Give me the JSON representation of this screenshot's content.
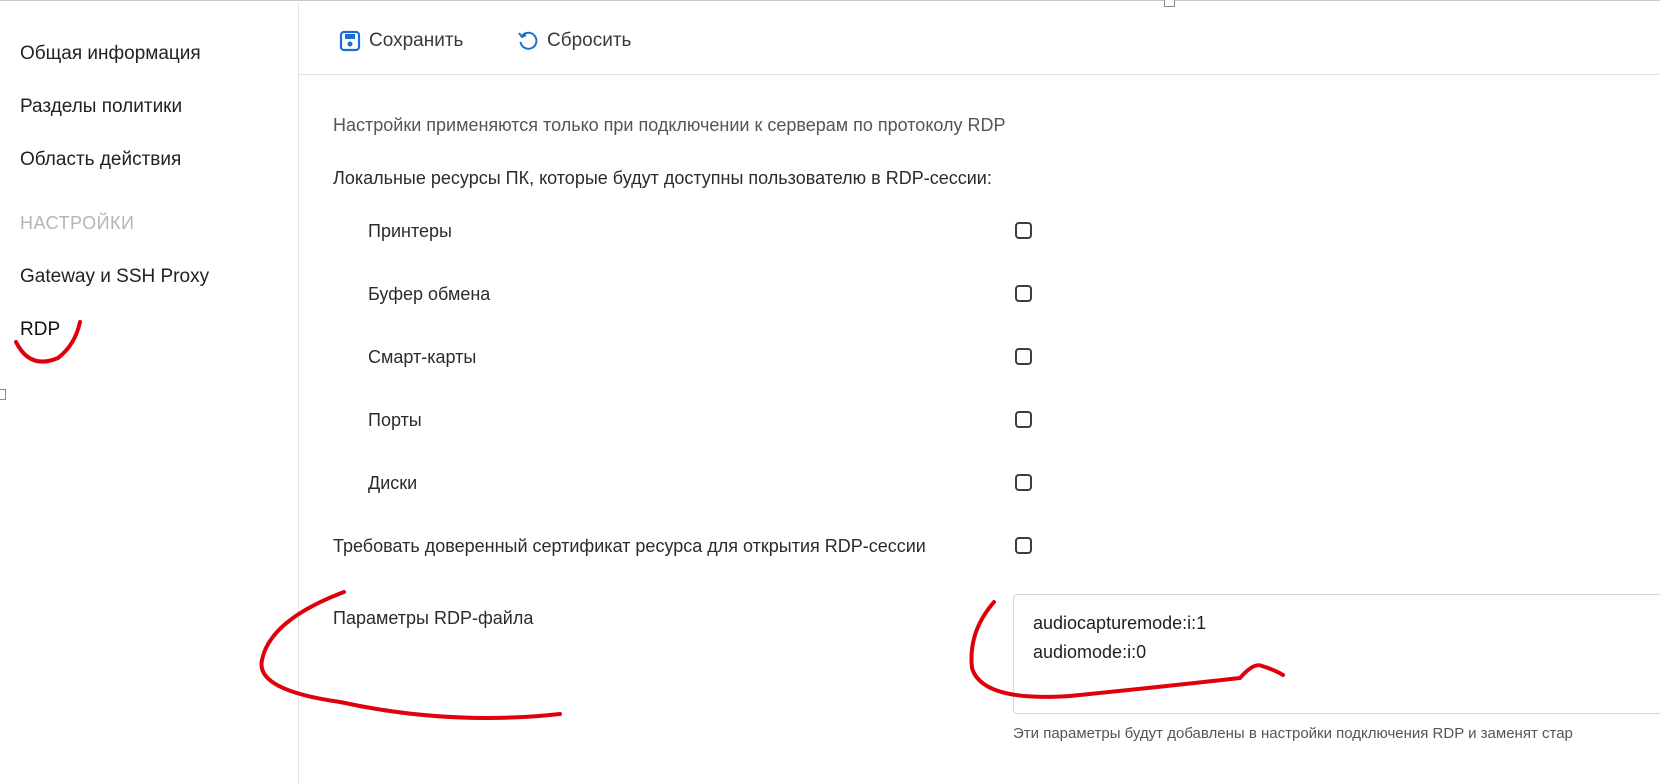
{
  "sidebar": {
    "items": [
      {
        "label": "Общая информация"
      },
      {
        "label": "Разделы политики"
      },
      {
        "label": "Область действия"
      }
    ],
    "section_header": "НАСТРОЙКИ",
    "settings_items": [
      {
        "label": "Gateway и SSH Proxy"
      },
      {
        "label": "RDP",
        "active": true
      }
    ]
  },
  "toolbar": {
    "save_label": "Сохранить",
    "reset_label": "Сбросить",
    "save_icon": "save-icon",
    "reset_icon": "reset-icon",
    "accent_color": "#1a6fd6"
  },
  "main": {
    "info_text": "Настройки применяются только при подключении к серверам по протоколу RDP",
    "resources_label": "Локальные ресурсы ПК, которые будут доступны пользователю в RDP-сессии:",
    "resources": [
      {
        "label": "Принтеры",
        "checked": false
      },
      {
        "label": "Буфер обмена",
        "checked": false
      },
      {
        "label": "Смарт-карты",
        "checked": false
      },
      {
        "label": "Порты",
        "checked": false
      },
      {
        "label": "Диски",
        "checked": false
      }
    ],
    "trusted_cert_label": "Требовать доверенный сертификат ресурса для открытия RDP-сессии",
    "trusted_cert_checked": false,
    "rdp_params_label": "Параметры RDP-файла",
    "rdp_params_lines": [
      "audiocapturemode:i:1",
      "audiomode:i:0"
    ],
    "rdp_params_hint": "Эти параметры будут добавлены в настройки подключения RDP и заменят стар"
  },
  "annotation_color": "#e0000a"
}
